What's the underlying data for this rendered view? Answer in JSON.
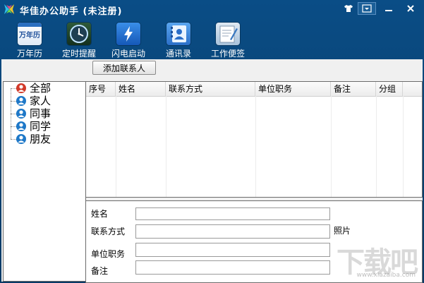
{
  "window": {
    "title": "华佳办公助手 (未注册)"
  },
  "toolbar": {
    "items": [
      {
        "label": "万年历",
        "icon": "calendar-icon",
        "icon_text": "万年历"
      },
      {
        "label": "定时提醒",
        "icon": "clock-icon"
      },
      {
        "label": "闪电启动",
        "icon": "lightning-icon"
      },
      {
        "label": "通讯录",
        "icon": "contacts-book-icon"
      },
      {
        "label": "工作便签",
        "icon": "notes-icon"
      }
    ]
  },
  "actions": {
    "add_contact": "添加联系人"
  },
  "groups": [
    {
      "label": "全部",
      "icon": "user-red-icon",
      "color": "#d23a2a"
    },
    {
      "label": "家人",
      "icon": "user-blue-icon",
      "color": "#1e78c8"
    },
    {
      "label": "同事",
      "icon": "user-blue-icon",
      "color": "#1e78c8"
    },
    {
      "label": "同学",
      "icon": "user-blue-icon",
      "color": "#1e78c8"
    },
    {
      "label": "朋友",
      "icon": "user-blue-icon",
      "color": "#1e78c8"
    }
  ],
  "table": {
    "columns": [
      "序号",
      "姓名",
      "联系方式",
      "单位职务",
      "备注",
      "分组"
    ],
    "rows": []
  },
  "form": {
    "name_label": "姓名",
    "contact_label": "联系方式",
    "photo_label": "照片",
    "position_label": "单位职务",
    "note_label": "备注",
    "name_value": "",
    "contact_value": "",
    "position_value": "",
    "note_value": ""
  },
  "watermark": {
    "text": "下载吧",
    "url": "www.xiazaiba.com"
  },
  "colors": {
    "titlebar": "#0a4d86",
    "accent_blue": "#1e78c8",
    "accent_red": "#d23a2a"
  }
}
